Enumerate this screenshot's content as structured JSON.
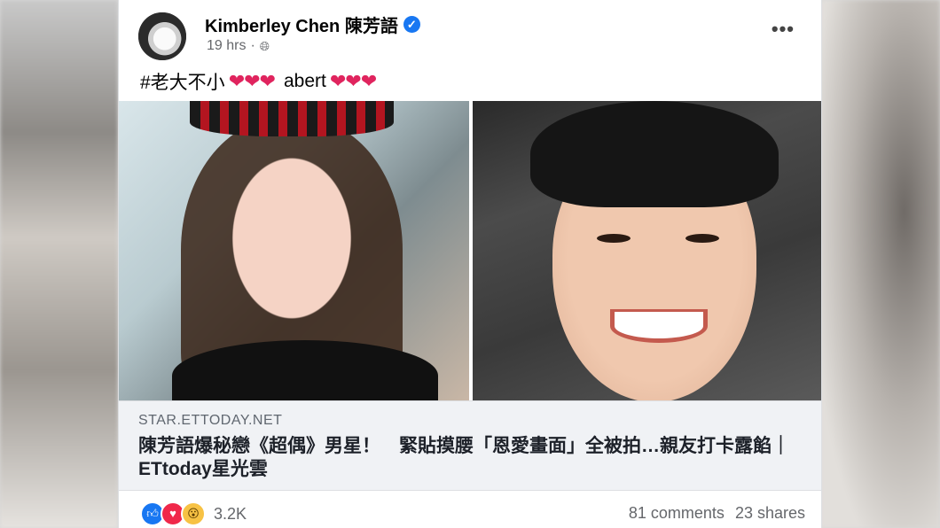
{
  "post": {
    "author": "Kimberley Chen 陳芳語",
    "time": "19 hrs",
    "separator": "·",
    "text_tag": "#老大不小",
    "text_name": "abert",
    "hearts": "❤❤❤"
  },
  "icons": {
    "verified": "verified-badge-icon",
    "privacy": "globe-icon",
    "more": "more-options-icon"
  },
  "link": {
    "domain": "STAR.ETTODAY.NET",
    "headline": "陳芳語爆秘戀《超偶》男星！　緊貼摸腰「恩愛畫面」全被拍…親友打卡露餡｜ETtoday星光雲"
  },
  "footer": {
    "reaction_count": "3.2K",
    "comments": "81 comments",
    "shares": "23 shares"
  },
  "colors": {
    "accent": "#1877f2",
    "love": "#f0284a",
    "wow": "#f7c244"
  }
}
